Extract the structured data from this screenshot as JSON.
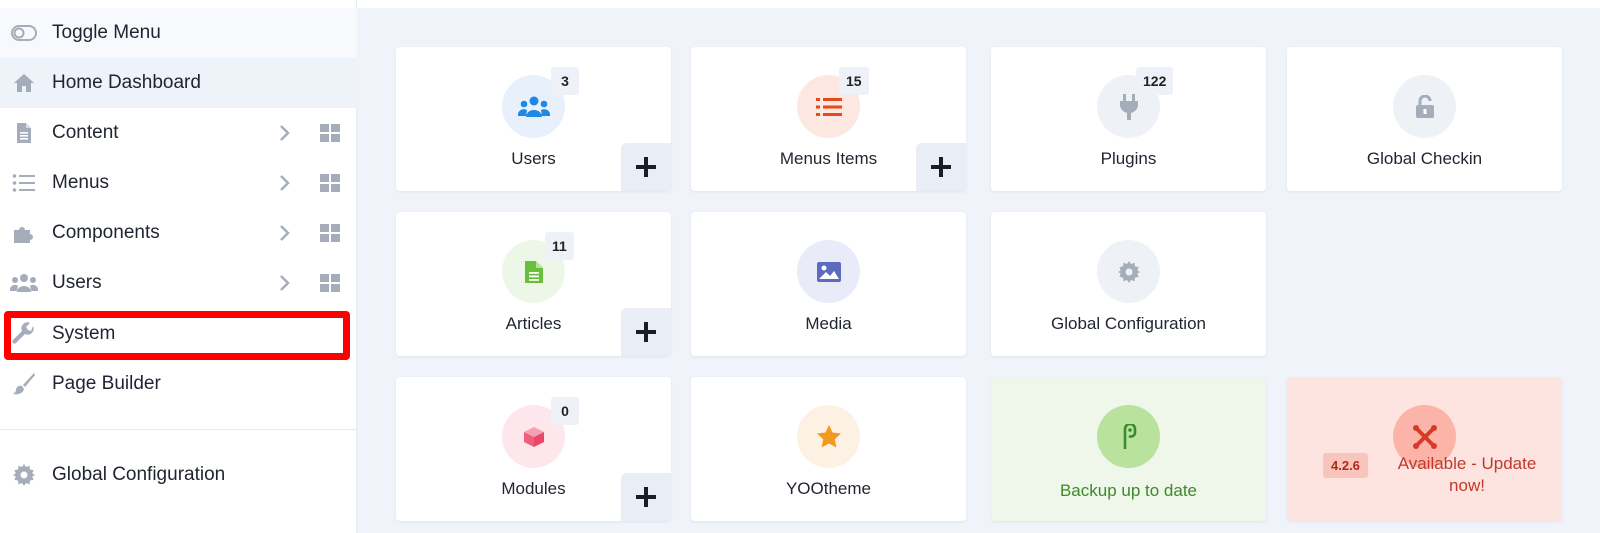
{
  "sidebar": {
    "toggle_label": "Toggle Menu",
    "items": [
      {
        "label": "Home Dashboard",
        "icon": "home-icon"
      },
      {
        "label": "Content",
        "icon": "file-icon"
      },
      {
        "label": "Menus",
        "icon": "list-icon"
      },
      {
        "label": "Components",
        "icon": "puzzle-icon"
      },
      {
        "label": "Users",
        "icon": "users-icon"
      },
      {
        "label": "System",
        "icon": "wrench-icon"
      },
      {
        "label": "Page Builder",
        "icon": "brush-icon"
      }
    ],
    "footer_item": {
      "label": "Global Configuration",
      "icon": "gear-icon"
    }
  },
  "cards": {
    "users": {
      "label": "Users",
      "count": "3",
      "icon": "users-icon",
      "color": "#1e88e5"
    },
    "menus": {
      "label": "Menus Items",
      "count": "15",
      "icon": "list-icon",
      "color": "#e64a19"
    },
    "plugins": {
      "label": "Plugins",
      "count": "122",
      "icon": "plug-icon",
      "color": "#9aa3b2"
    },
    "checkin": {
      "label": "Global Checkin",
      "icon": "unlock-icon",
      "color": "#9aa3b2"
    },
    "articles": {
      "label": "Articles",
      "count": "11",
      "icon": "article-icon",
      "color": "#6abf3a"
    },
    "media": {
      "label": "Media",
      "icon": "image-icon",
      "color": "#5c6bc0"
    },
    "globalconfig": {
      "label": "Global Configuration",
      "icon": "gear-icon",
      "color": "#9aa3b2"
    },
    "modules": {
      "label": "Modules",
      "count": "0",
      "icon": "cube-icon",
      "color": "#ef5f7a"
    },
    "yootheme": {
      "label": "YOOtheme",
      "icon": "star-icon",
      "color": "#f29a1f"
    },
    "backup": {
      "label": "Backup up to date",
      "icon": "backup-icon",
      "color": "#3d8a2a"
    },
    "update": {
      "version": "4.2.6",
      "text": "Available - Update now!",
      "icon": "joomla-icon",
      "color": "#c0392b"
    }
  }
}
